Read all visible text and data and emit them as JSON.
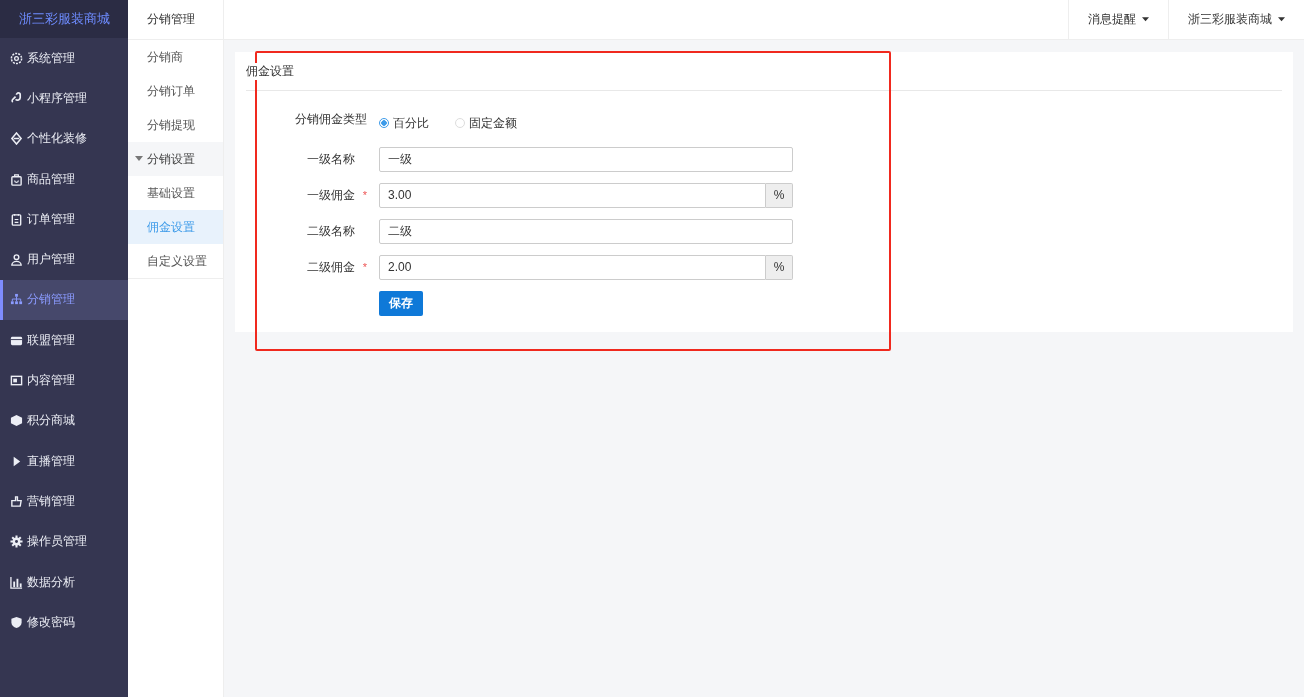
{
  "sidebar": {
    "brand": "浙三彩服装商城",
    "items": [
      {
        "label": "系统管理",
        "selected": false
      },
      {
        "label": "小程序管理",
        "selected": false
      },
      {
        "label": "个性化装修",
        "selected": false
      },
      {
        "label": "商品管理",
        "selected": false
      },
      {
        "label": "订单管理",
        "selected": false
      },
      {
        "label": "用户管理",
        "selected": false
      },
      {
        "label": "分销管理",
        "selected": true
      },
      {
        "label": "联盟管理",
        "selected": false
      },
      {
        "label": "内容管理",
        "selected": false
      },
      {
        "label": "积分商城",
        "selected": false
      },
      {
        "label": "直播管理",
        "selected": false
      },
      {
        "label": "营销管理",
        "selected": false
      },
      {
        "label": "操作员管理",
        "selected": false
      },
      {
        "label": "数据分析",
        "selected": false
      },
      {
        "label": "修改密码",
        "selected": false
      }
    ]
  },
  "submenu": {
    "title": "分销管理",
    "items": [
      {
        "label": "分销商",
        "selected": false
      },
      {
        "label": "分销订单",
        "selected": false
      },
      {
        "label": "分销提现",
        "selected": false
      },
      {
        "label": "分销设置",
        "expanded": true,
        "children": [
          {
            "label": "基础设置",
            "selected": false
          },
          {
            "label": "佣金设置",
            "selected": true
          },
          {
            "label": "自定义设置",
            "selected": false
          }
        ]
      }
    ]
  },
  "topbar": {
    "items": [
      "消息提醒",
      "浙三彩服装商城"
    ]
  },
  "panel": {
    "title": "佣金设置",
    "commission_type": {
      "label": "分销佣金类型",
      "options": [
        {
          "label": "百分比",
          "selected": true
        },
        {
          "label": "固定金额",
          "selected": false
        }
      ]
    },
    "fields": [
      {
        "label": "一级名称",
        "value": "一级"
      },
      {
        "label": "一级佣金",
        "value": "3.00",
        "required_mark": "*",
        "addon": "%"
      },
      {
        "label": "二级名称",
        "value": "二级"
      },
      {
        "label": "二级佣金",
        "value": "2.00",
        "required_mark": "*",
        "addon": "%"
      }
    ],
    "save_button": "保存"
  }
}
